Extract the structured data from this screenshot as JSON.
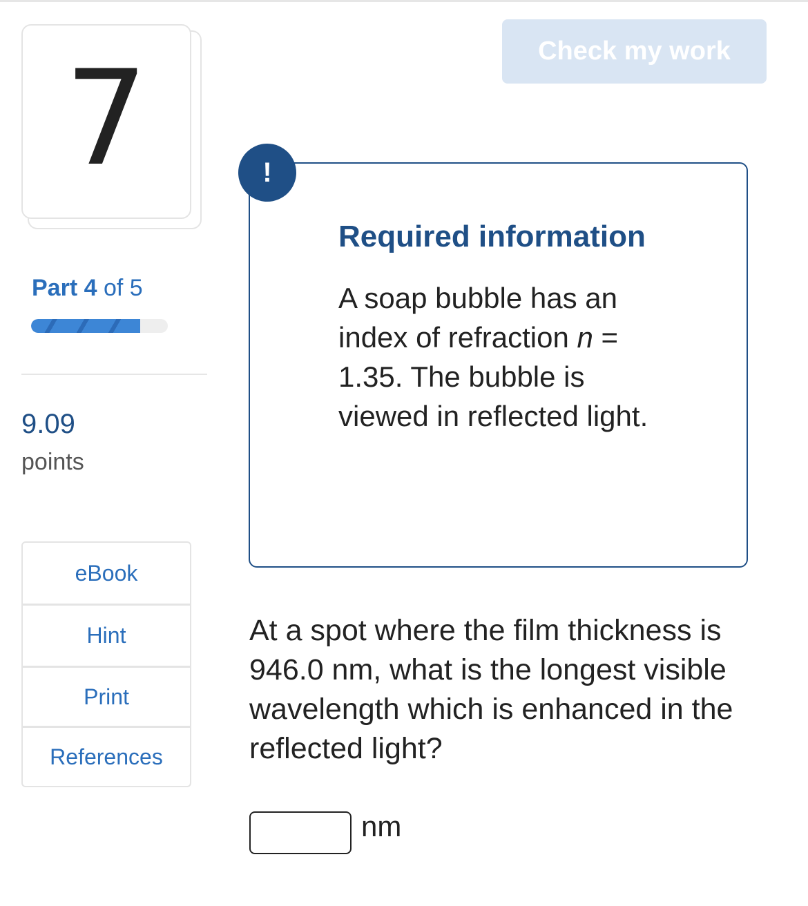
{
  "question": {
    "number": "7",
    "part_label_prefix": "Part",
    "part_current": "4",
    "part_of": "of 5",
    "progress_fraction": 0.8,
    "points_value": "9.09",
    "points_label": "points"
  },
  "tools": [
    {
      "label": "eBook"
    },
    {
      "label": "Hint"
    },
    {
      "label": "Print"
    },
    {
      "label": "References"
    }
  ],
  "toolbar": {
    "check_label": "Check my work"
  },
  "info": {
    "badge": "!",
    "title": "Required information",
    "body_before": "A soap bubble has an index of refraction ",
    "variable": "n",
    "body_after": " = 1.35. The bubble is viewed in reflected light."
  },
  "main": {
    "question_text": "At a spot where the film thickness is 946.0 nm, what is the longest visible wavelength which is enhanced in the reflected light?",
    "answer_value": "",
    "answer_unit": "nm"
  },
  "colors": {
    "brand_blue": "#1f4f86",
    "link_blue": "#2a6ebb",
    "button_disabled": "#d9e5f3"
  }
}
